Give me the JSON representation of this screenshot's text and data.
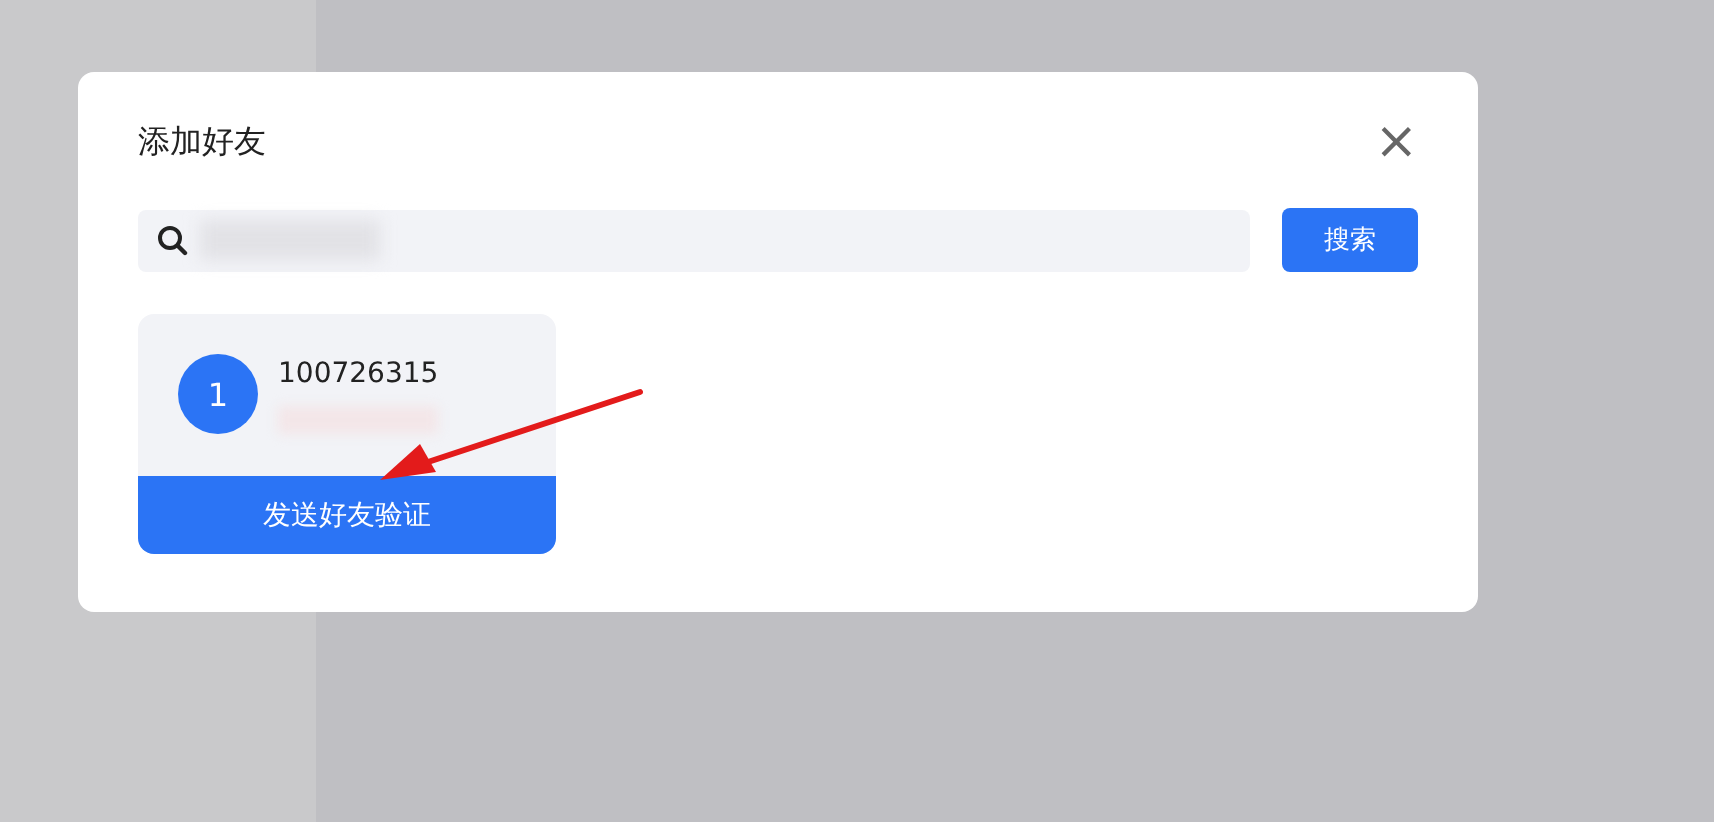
{
  "dialog": {
    "title": "添加好友",
    "close": "×"
  },
  "search": {
    "button": "搜索"
  },
  "results": [
    {
      "avatar": "1",
      "account": "100726315",
      "action": "发送好友验证"
    }
  ]
}
